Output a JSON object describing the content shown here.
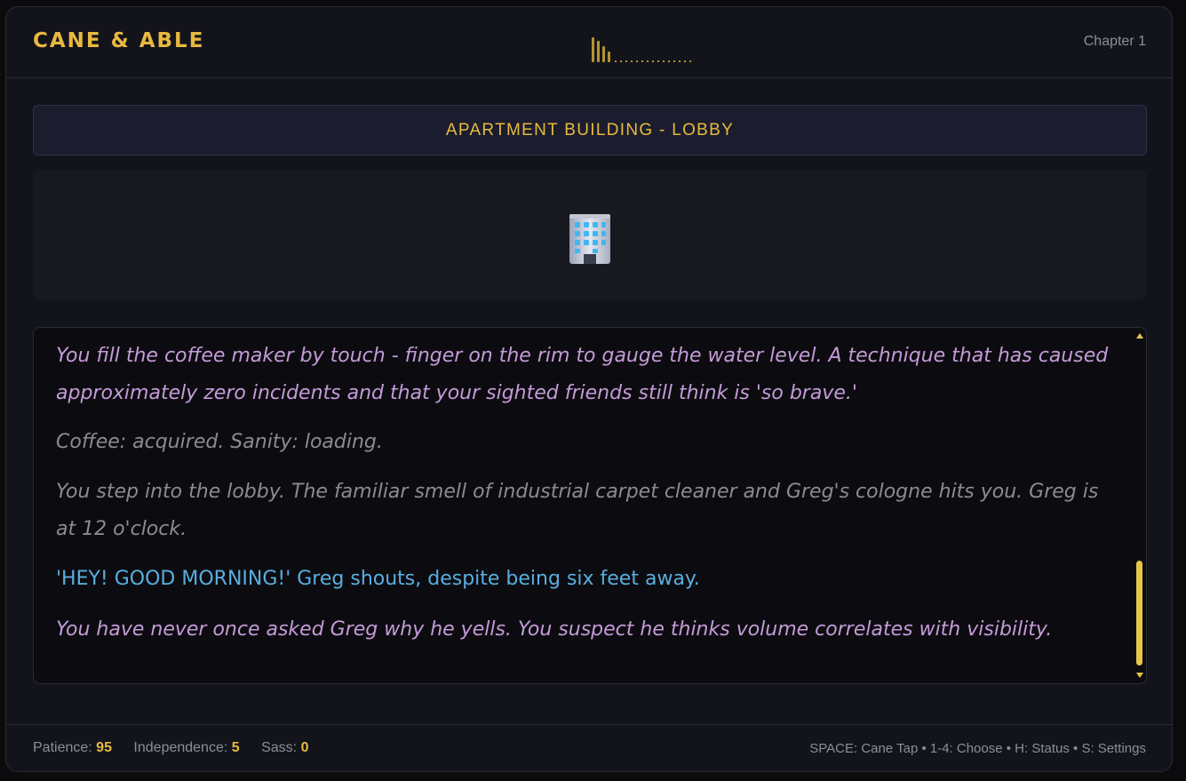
{
  "header": {
    "title": "CANE & ABLE",
    "chapter": "Chapter 1"
  },
  "location": {
    "name": "APARTMENT BUILDING - LOBBY",
    "icon": "office-building-icon"
  },
  "log": {
    "entries": [
      "You fill the coffee maker by touch - finger on the rim to gauge the water level. A technique that has caused approximately zero incidents and that your sighted friends still think is 'so brave.'",
      "Coffee: acquired. Sanity: loading.",
      "You step into the lobby. The familiar smell of industrial carpet cleaner and Greg's cologne hits you. Greg is at 12 o'clock.",
      "'HEY! GOOD MORNING!' Greg shouts, despite being six feet away.",
      "You have never once asked Greg why he yells. You suspect he thinks volume correlates with visibility."
    ]
  },
  "footer": {
    "stats": [
      {
        "label": "Patience:",
        "value": "95"
      },
      {
        "label": "Independence:",
        "value": "5"
      },
      {
        "label": "Sass:",
        "value": "0"
      }
    ],
    "help": "SPACE: Cane Tap • 1-4: Choose • H: Status • S: Settings"
  },
  "colors": {
    "accent": "#e8b93f",
    "narration": "#c59ad8",
    "muted": "#8a8b93",
    "speech": "#5aaee0",
    "background": "#13141b"
  }
}
